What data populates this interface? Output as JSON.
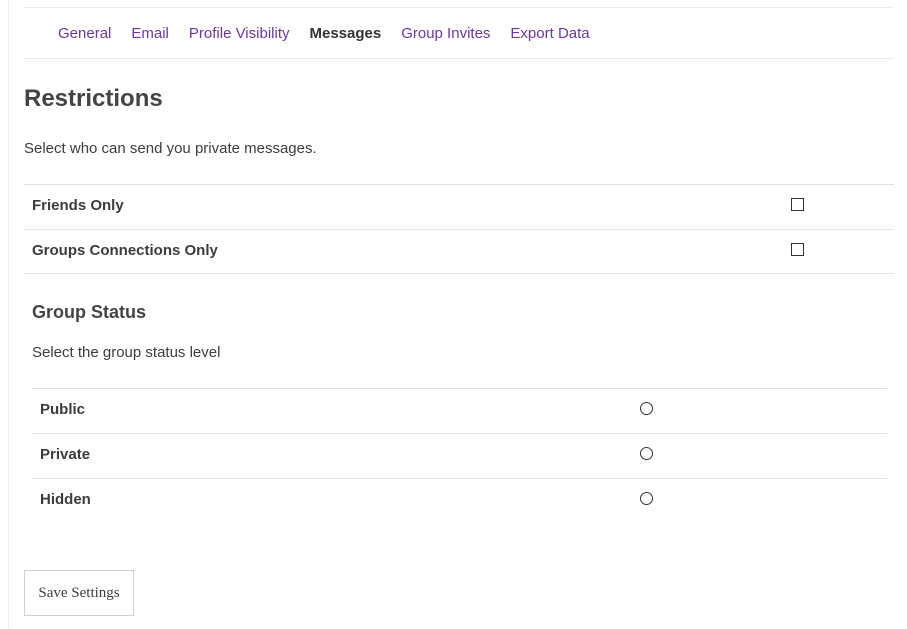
{
  "tabs": [
    {
      "label": "General",
      "active": false
    },
    {
      "label": "Email",
      "active": false
    },
    {
      "label": "Profile Visibility",
      "active": false
    },
    {
      "label": "Messages",
      "active": true
    },
    {
      "label": "Group Invites",
      "active": false
    },
    {
      "label": "Export Data",
      "active": false
    }
  ],
  "restrictions": {
    "title": "Restrictions",
    "description": "Select who can send you private messages.",
    "options": [
      {
        "label": "Friends Only",
        "checked": false
      },
      {
        "label": "Groups Connections Only",
        "checked": false
      }
    ]
  },
  "group_status": {
    "title": "Group Status",
    "description": "Select the group status level",
    "options": [
      {
        "label": "Public",
        "selected": false
      },
      {
        "label": "Private",
        "selected": false
      },
      {
        "label": "Hidden",
        "selected": false
      }
    ]
  },
  "save_button": {
    "label": "Save Settings"
  },
  "colors": {
    "link": "#70369d",
    "text": "#3c3c3c",
    "border": "#e2e2e2"
  }
}
